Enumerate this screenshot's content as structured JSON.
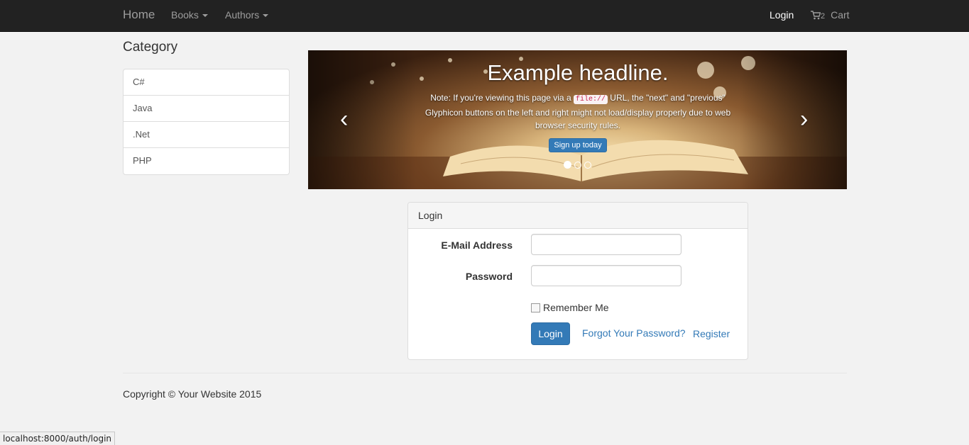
{
  "navbar": {
    "brand": "Home",
    "books": "Books",
    "authors": "Authors",
    "login": "Login",
    "cart_count": "2",
    "cart": "Cart"
  },
  "sidebar": {
    "title": "Category",
    "items": [
      {
        "label": "C#"
      },
      {
        "label": "Java"
      },
      {
        "label": ".Net"
      },
      {
        "label": "PHP"
      }
    ]
  },
  "carousel": {
    "headline": "Example headline.",
    "note_before": "Note: If you're viewing this page via a ",
    "note_code": "file://",
    "note_after": " URL, the \"next\" and \"previous\" Glyphicon buttons on the left and right might not load/display properly due to web browser security rules.",
    "button": "Sign up today",
    "prev_glyph": "‹",
    "next_glyph": "›"
  },
  "login_panel": {
    "heading": "Login",
    "email_label": "E-Mail Address",
    "email_value": "",
    "password_label": "Password",
    "password_value": "",
    "remember_label": "Remember Me",
    "login_button": "Login",
    "forgot_link": "Forgot Your Password?",
    "register_link": "Register"
  },
  "footer": {
    "copyright": "Copyright © Your Website 2015"
  },
  "statusbar": {
    "url": "localhost:8000/auth/login"
  },
  "colors": {
    "navbar_bg": "#222222",
    "primary": "#337ab7",
    "page_bg": "#f2f2f2"
  }
}
